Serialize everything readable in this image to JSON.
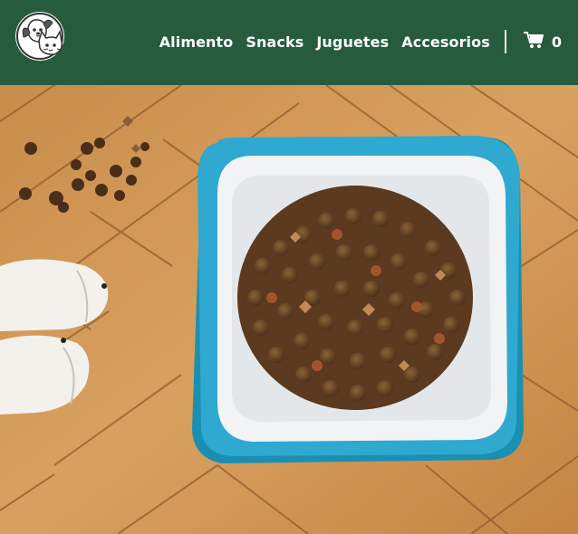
{
  "header": {
    "logo_icon": "dog-cat-logo-icon",
    "nav_items": [
      "Alimento",
      "Snacks",
      "Juguetes",
      "Accesorios"
    ],
    "cart": {
      "icon": "cart-icon",
      "count": "0"
    }
  },
  "hero": {
    "image_subject": "dog-food-bowl"
  },
  "colors": {
    "navbar": "#265c3d",
    "text": "#ffffff",
    "wood": "#d49a57",
    "bowl_blue": "#2fa9cf"
  }
}
